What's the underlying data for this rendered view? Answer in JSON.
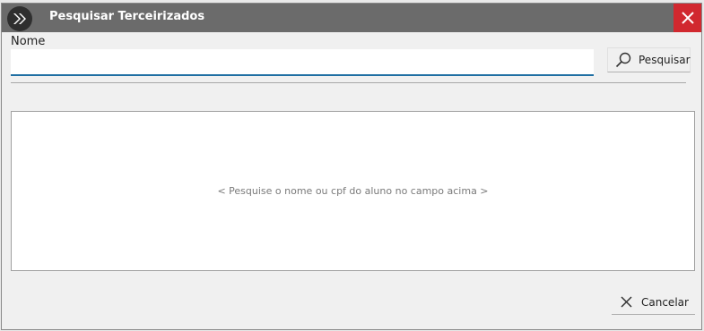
{
  "window": {
    "title": "Pesquisar Terceirizados",
    "title_bar_color": "#6b6b6b",
    "close_button_color": "#d1282f",
    "logo_icon": "double-chevron-right-icon",
    "close_icon": "close-icon"
  },
  "form": {
    "name_label": "Nome",
    "name_value": "",
    "input_accent_color": "#1f6fa3",
    "search_button": {
      "label": "Pesquisar",
      "icon": "search-icon"
    }
  },
  "results": {
    "empty_message": "< Pesquise o nome ou cpf do aluno no campo acima >"
  },
  "footer": {
    "cancel_button": {
      "label": "Cancelar",
      "icon": "close-icon"
    }
  }
}
